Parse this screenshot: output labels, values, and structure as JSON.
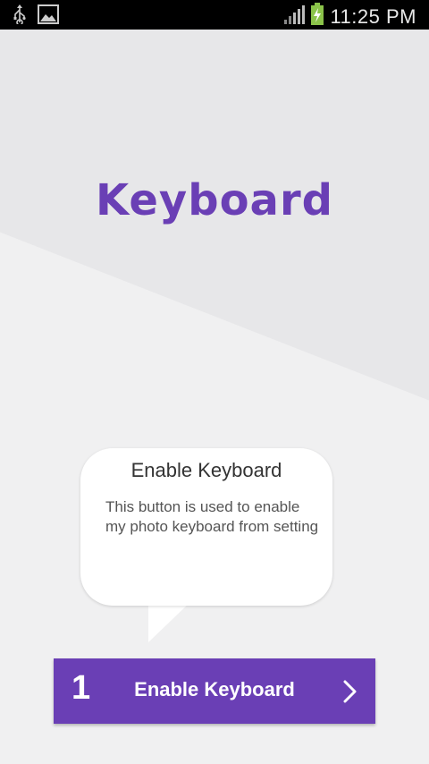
{
  "status_bar": {
    "time": "11:25 PM",
    "icons": [
      "usb-icon",
      "image-icon",
      "signal-icon",
      "battery-charging-icon"
    ]
  },
  "logo": {
    "text": "Keyboard",
    "color": "#6a3fb5"
  },
  "tooltip": {
    "title": "Enable Keyboard",
    "body": "This button is used to enable my photo keyboard from setting"
  },
  "enable_button": {
    "step": "1",
    "label": "Enable Keyboard",
    "color": "#6a3fb5"
  },
  "colors": {
    "accent": "#6a3fb5",
    "status_bar_bg": "#000000",
    "battery": "#8bc34a"
  }
}
